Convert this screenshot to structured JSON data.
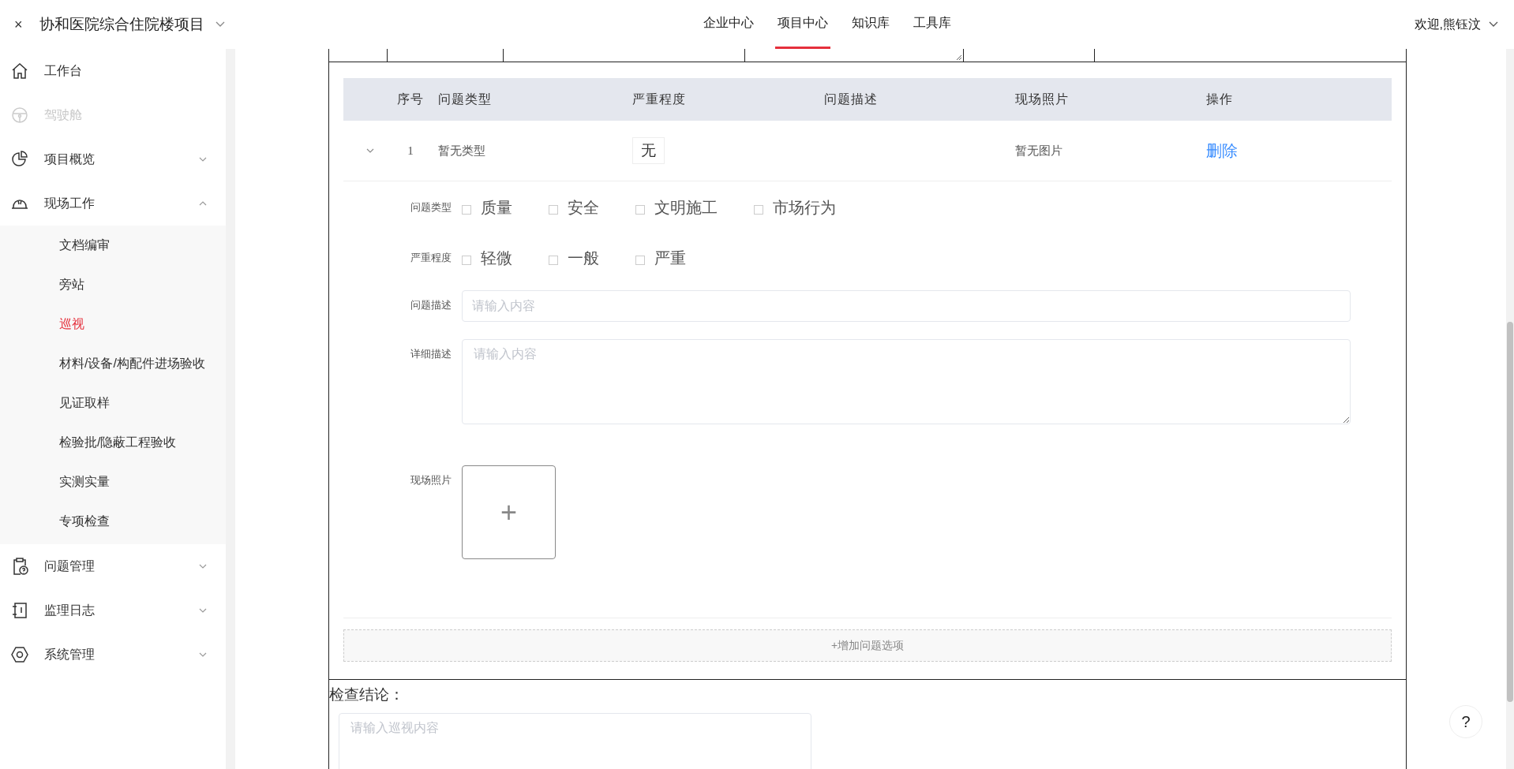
{
  "project": {
    "close": "×",
    "name": "协和医院综合住院楼项目"
  },
  "nav_tabs": [
    {
      "label": "企业中心",
      "selected": false
    },
    {
      "label": "项目中心",
      "selected": true
    },
    {
      "label": "知识库",
      "selected": false
    },
    {
      "label": "工具库",
      "selected": false
    }
  ],
  "user": {
    "greeting": "欢迎,熊钰汶"
  },
  "sidebar": {
    "items": [
      {
        "kind": "home",
        "label": "工作台",
        "disabled": false
      },
      {
        "kind": "wheel",
        "label": "驾驶舱",
        "disabled": true
      },
      {
        "kind": "pie",
        "label": "项目概览",
        "disabled": false,
        "expanded": false
      },
      {
        "kind": "helmet",
        "label": "现场工作",
        "disabled": false,
        "expanded": true,
        "children": [
          {
            "label": "文档编审",
            "selected": false
          },
          {
            "label": "旁站",
            "selected": false
          },
          {
            "label": "巡视",
            "selected": true
          },
          {
            "label": "材料/设备/构配件进场验收",
            "selected": false
          },
          {
            "label": "见证取样",
            "selected": false
          },
          {
            "label": "检验批/隐蔽工程验收",
            "selected": false
          },
          {
            "label": "实测实量",
            "selected": false
          },
          {
            "label": "专项检查",
            "selected": false
          }
        ]
      },
      {
        "kind": "clipboard",
        "label": "问题管理",
        "disabled": false,
        "expanded": false
      },
      {
        "kind": "notebook",
        "label": "监理日志",
        "disabled": false,
        "expanded": false
      },
      {
        "kind": "hexagon",
        "label": "系统管理",
        "disabled": false,
        "expanded": false
      }
    ]
  },
  "issue_table": {
    "columns": [
      "序号",
      "问题类型",
      "严重程度",
      "问题描述",
      "现场照片",
      "操作"
    ],
    "rows": [
      {
        "expanded": true,
        "index": "1",
        "type": "暂无类型",
        "severity": "无",
        "photo": "暂无图片",
        "action": "删除"
      }
    ]
  },
  "issue_form": {
    "problem_type": {
      "label": "问题类型",
      "options": [
        {
          "label": "质量",
          "checked": false
        },
        {
          "label": "安全",
          "checked": false
        },
        {
          "label": "文明施工",
          "checked": false
        },
        {
          "label": "市场行为",
          "checked": false
        }
      ]
    },
    "severity": {
      "label": "严重程度",
      "options": [
        {
          "label": "轻微",
          "checked": false
        },
        {
          "label": "一般",
          "checked": false
        },
        {
          "label": "严重",
          "checked": false
        }
      ]
    },
    "description": {
      "label": "问题描述",
      "placeholder": "请输入内容"
    },
    "detail": {
      "label": "详细描述",
      "placeholder": "请输入内容"
    },
    "photos": {
      "label": "现场照片",
      "add": "+"
    }
  },
  "add_issue_button": "+增加问题选项",
  "conclusion": {
    "label": "检查结论：",
    "placeholder": "请输入巡视内容"
  },
  "help_button": "?"
}
